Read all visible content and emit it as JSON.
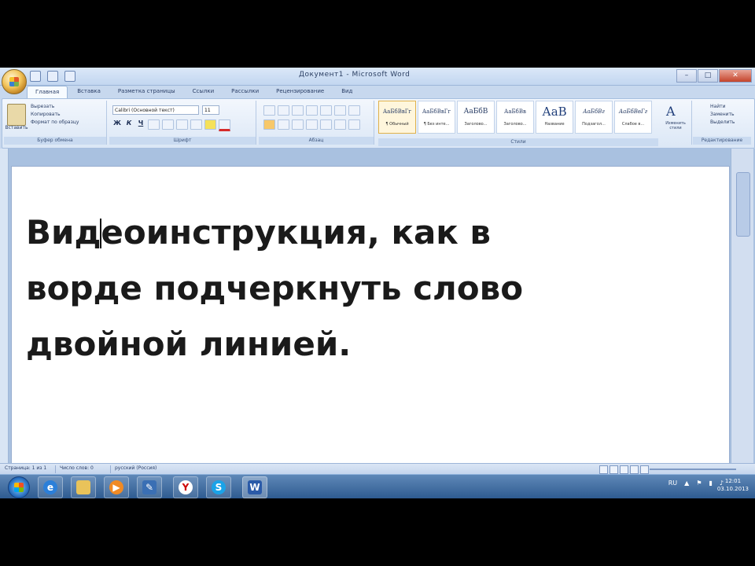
{
  "window": {
    "title": "Документ1 - Microsoft Word"
  },
  "tabs": [
    "Главная",
    "Вставка",
    "Разметка страницы",
    "Ссылки",
    "Рассылки",
    "Рецензирование",
    "Вид"
  ],
  "ribbon": {
    "clipboard": {
      "paste": "Вставить",
      "cut": "Вырезать",
      "copy": "Копировать",
      "format_painter": "Формат по образцу",
      "label": "Буфер обмена"
    },
    "font": {
      "name": "Calibri (Основной текст)",
      "size": "11",
      "label": "Шрифт",
      "bold": "Ж",
      "italic": "К",
      "underline": "Ч"
    },
    "paragraph": {
      "label": "Абзац"
    },
    "styles": {
      "label": "Стили",
      "items": [
        {
          "sample": "АаБбВвГг",
          "name": "¶ Обычный"
        },
        {
          "sample": "АаБбВвГг",
          "name": "¶ Без инте..."
        },
        {
          "sample": "АаБбВ",
          "name": "Заголово..."
        },
        {
          "sample": "АаБбВв",
          "name": "Заголово..."
        },
        {
          "sample": "АаВ",
          "name": "Название"
        },
        {
          "sample": "АаБбВг",
          "name": "Подзагол..."
        },
        {
          "sample": "АаБбВвГг",
          "name": "Слабое в..."
        }
      ],
      "change_styles": "Изменить стили"
    },
    "editing": {
      "find": "Найти",
      "replace": "Заменить",
      "select": "Выделить",
      "label": "Редактирование"
    }
  },
  "document": {
    "lines": [
      {
        "before_caret": "Вид",
        "after_caret": "еоинструкция, как в"
      },
      {
        "text": "ворде подчеркнуть слово"
      },
      {
        "text": "двойной линией."
      }
    ]
  },
  "statusbar": {
    "page": "Страница: 1 из 1",
    "words": "Число слов: 0",
    "language": "русский (Россия)"
  },
  "taskbar": {
    "apps": [
      "ie",
      "explorer",
      "media",
      "paint",
      "yandex",
      "skype",
      "word"
    ],
    "tray_lang": "RU",
    "time": "12:01",
    "date": "03.10.2013"
  }
}
